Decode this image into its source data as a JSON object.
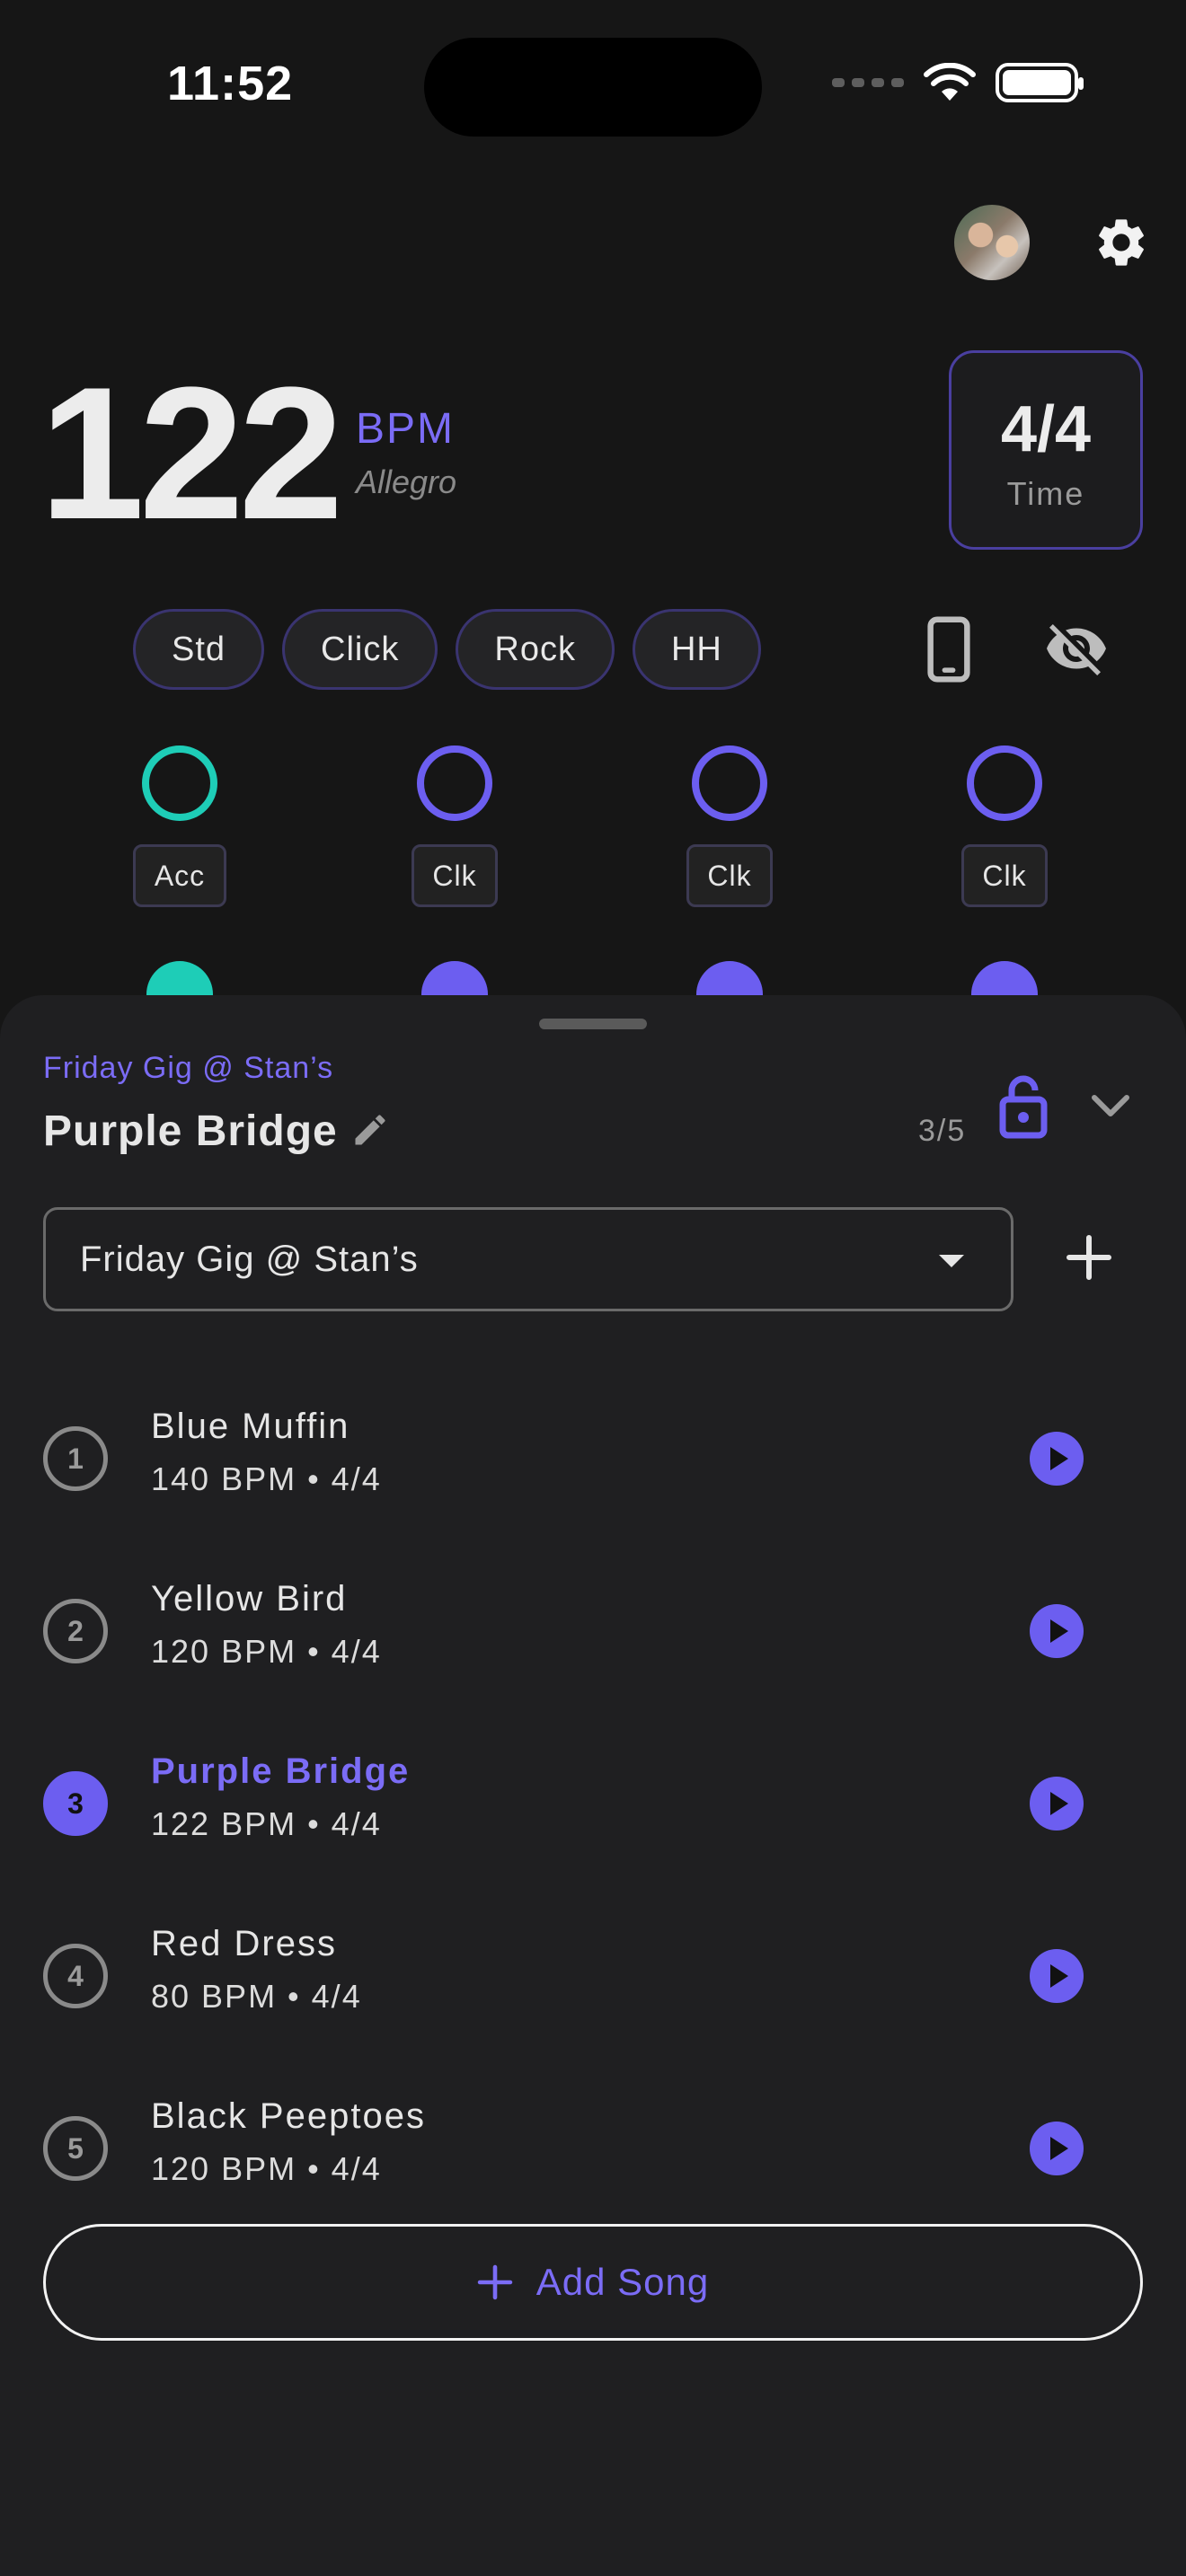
{
  "status": {
    "time": "11:52"
  },
  "tempo": {
    "bpm": "122",
    "unit": "BPM",
    "name": "Allegro"
  },
  "time_signature": {
    "value": "4/4",
    "label": "Time"
  },
  "sounds": [
    "Std",
    "Click",
    "Rock",
    "HH"
  ],
  "beats": [
    {
      "tag": "Acc",
      "accent": true
    },
    {
      "tag": "Clk",
      "accent": false
    },
    {
      "tag": "Clk",
      "accent": false
    },
    {
      "tag": "Clk",
      "accent": false
    }
  ],
  "sheet": {
    "setlist_name": "Friday Gig @ Stan’s",
    "current_song": "Purple Bridge",
    "position": "3/5",
    "dropdown_value": "Friday Gig @ Stan’s",
    "add_song_label": "Add Song"
  },
  "songs": [
    {
      "number": "1",
      "title": "Blue Muffin",
      "meta": "140 BPM • 4/4",
      "active": false
    },
    {
      "number": "2",
      "title": "Yellow Bird",
      "meta": "120 BPM • 4/4",
      "active": false
    },
    {
      "number": "3",
      "title": "Purple Bridge",
      "meta": "122 BPM • 4/4",
      "active": true
    },
    {
      "number": "4",
      "title": "Red Dress",
      "meta": "80 BPM • 4/4",
      "active": false
    },
    {
      "number": "5",
      "title": "Black Peeptoes",
      "meta": "120 BPM • 4/4",
      "active": false
    }
  ],
  "colors": {
    "accent": "#6c5ef0",
    "accent_text": "#7b6cf6",
    "teal": "#1ecdb7"
  },
  "icons": [
    "avatar",
    "gear-icon",
    "phone-icon",
    "eye-off-icon",
    "pencil-icon",
    "lock-open-icon",
    "chevron-down-icon",
    "plus-icon",
    "play-icon"
  ]
}
